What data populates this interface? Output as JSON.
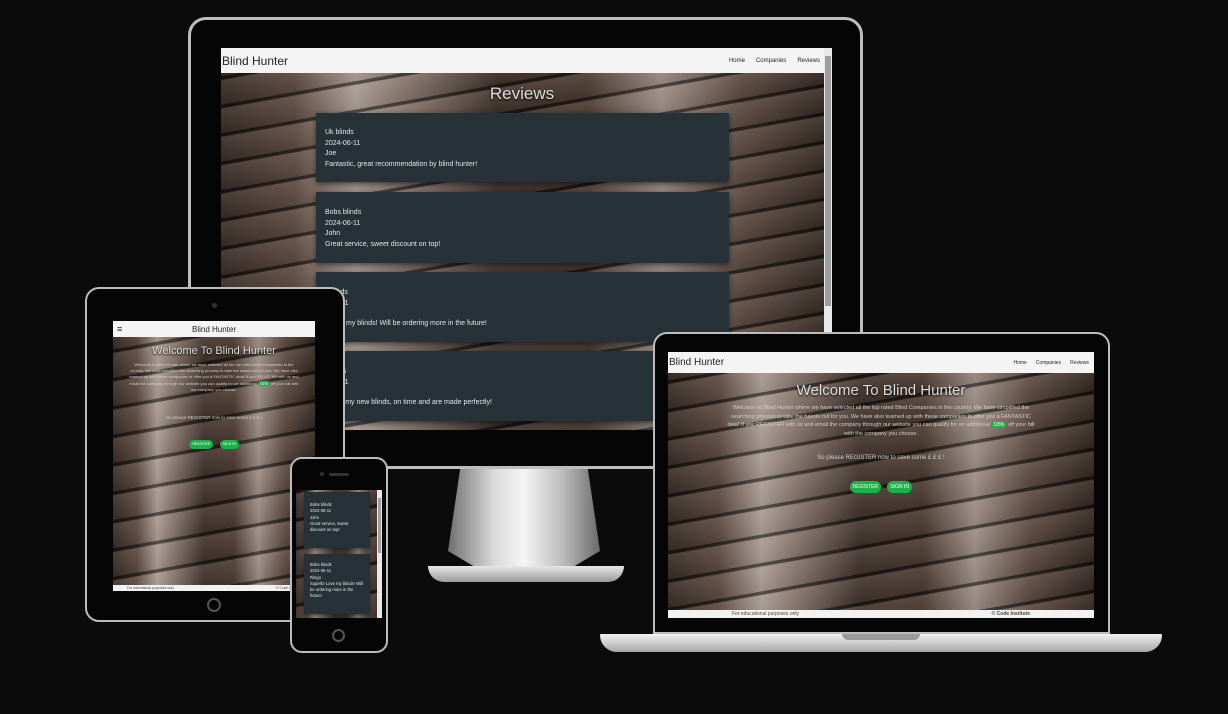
{
  "monitor": {
    "brand": "Blind Hunter",
    "nav": [
      "Home",
      "Companies",
      "Reviews"
    ],
    "title": "Reviews",
    "reviews": [
      {
        "company": "Uk blinds",
        "date": "2024-06-11",
        "author": "Joe",
        "text": "Fantastic, great recommendation by blind hunter!"
      },
      {
        "company": "Bobs blinds",
        "date": "2024-06-11",
        "author": "John",
        "text": "Great service, sweet discount on top!"
      },
      {
        "company": "inds",
        "date": "6-11",
        "author": "",
        "text": "! Love my blinds! Will be ordering more in the future!"
      },
      {
        "company": "nds",
        "date": "6-11",
        "author": "",
        "text": "d with my new blinds, on time and are made perfectly!"
      }
    ]
  },
  "laptop": {
    "brand": "Blind Hunter",
    "nav": [
      "Home",
      "Companies",
      "Reviews"
    ],
    "title": "Welcome To Blind Hunter",
    "intro_a": "Welcome to Blind Hunter where we have selected all the top rated Blind Companies in the country. We have simplified the searching process to take the hassle out for you. We have also teamed up with these companies to offer you a FANTASTIC deal! If you REGISTER with us and email the company through our website you can qualify for an additional",
    "badge": "10%",
    "intro_b": "off your bill with the company you choose.",
    "cta": "So please REGISTER now to save some £ £ £ !",
    "register_label": "REGISTER",
    "signin_label": "SIGN IN",
    "footer_left": "For educational purposes only",
    "footer_right": "© Code Institute"
  },
  "tablet": {
    "menu_icon": "≡",
    "brand": "Blind Hunter",
    "title": "Welcome To Blind Hunter",
    "intro_a": "Welcome to Blind Hunter where we have selected all the top rated Blind Companies in the country. We have simplified the searching process to take the hassle out for you. We have also teamed up with these companies to offer you a FANTASTIC deal! If you REGISTER with us and email the company through our website you can qualify for an additional",
    "badge": "10%",
    "intro_b": "off your bill with the company you choose.",
    "cta": "So please REGISTER now to save some £ £ £ !",
    "register_label": "REGISTER",
    "signin_label": "SIGN IN",
    "footer_left": "For educational purposes only",
    "footer_right": "© Code Institute"
  },
  "phone": {
    "reviews": [
      {
        "company": "Bobs blinds",
        "date": "2024-06-11",
        "author": "John",
        "text": "Great service, sweet discount on top!"
      },
      {
        "company": "Bobs blinds",
        "date": "2024-06-11",
        "author": "Ringo",
        "text": "Superb! Love my blinds! Will be ordering more in the future!"
      }
    ]
  },
  "colors": {
    "card": "#263238",
    "accent_green": "#19b34a",
    "background": "#0b0b0b"
  }
}
